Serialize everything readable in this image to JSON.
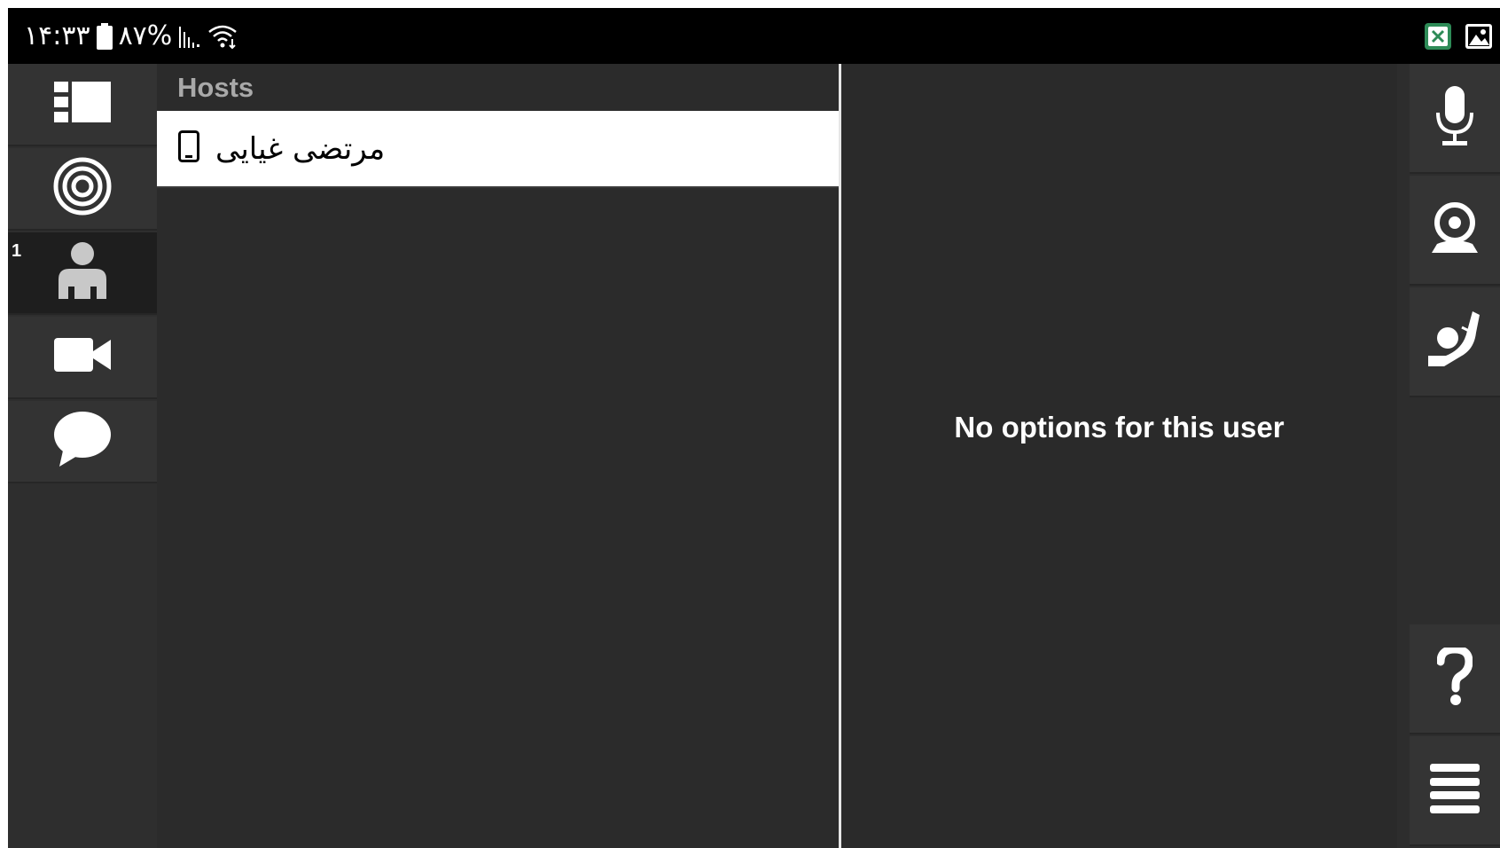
{
  "status_bar": {
    "time": "۱۴:۳۳",
    "battery_percent": "۸۷%",
    "icons": [
      "battery-icon",
      "signal-icon",
      "wifi-icon",
      "screen-record-icon",
      "gallery-icon"
    ]
  },
  "left_nav": {
    "items": [
      {
        "name": "layout-icon",
        "active": false
      },
      {
        "name": "target-icon",
        "active": false
      },
      {
        "name": "users-icon",
        "active": true,
        "badge": "1"
      },
      {
        "name": "video-camera-icon",
        "active": false
      },
      {
        "name": "chat-icon",
        "active": false
      }
    ]
  },
  "list_panel": {
    "header": "Hosts",
    "hosts": [
      {
        "name": "مرتضی غیایی",
        "device_icon": "phone-icon"
      }
    ]
  },
  "options_panel": {
    "message": "No options for this user"
  },
  "right_toolbar": {
    "buttons": [
      "microphone-icon",
      "webcam-icon",
      "raise-hand-icon",
      "help-icon",
      "menu-icon"
    ]
  },
  "colors": {
    "status_bar": "#000000",
    "background": "#2a2a2a",
    "icon": "#ffffff",
    "header_text": "#a9a9a9",
    "row_selected": "#ffffff",
    "record_icon": "#2e8b57"
  }
}
